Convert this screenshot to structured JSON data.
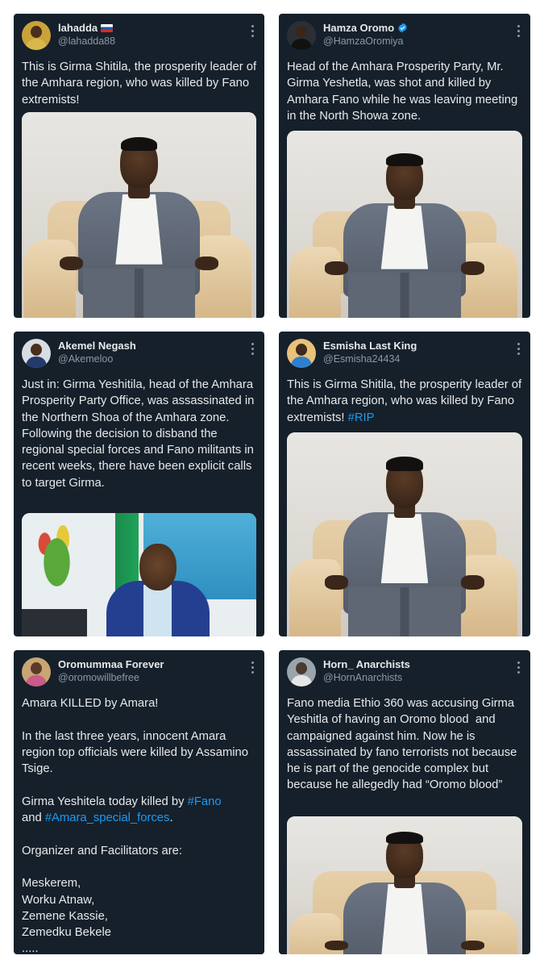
{
  "tweets": [
    {
      "name": "lahadda",
      "handle": "@lahadda88",
      "text": "This is Girma Shitila, the prosperity leader of the Amhara region, who was killed by Fano extremists!",
      "hashtag": "",
      "has_flag": true,
      "verified": false,
      "photo": "man-in-grey-suit-on-sofa"
    },
    {
      "name": "Hamza Oromo",
      "handle": "@HamzaOromiya",
      "text": "Head of the Amhara Prosperity Party, Mr. Girma Yeshetla, was shot and killed by Amhara Fano while he was leaving meeting in the North Showa zone.",
      "hashtag": "",
      "has_flag": false,
      "verified": true,
      "photo": "man-in-grey-suit-on-sofa"
    },
    {
      "name": "Akemel Negash",
      "handle": "@Akemeloo",
      "text": "Just in: Girma Yeshitila, head of the Amhara Prosperity Party Office, was assassinated in the Northern Shoa of the Amhara zone. Following the decision to disband the regional special forces and Fano militants in recent weeks, there have been explicit calls to target Girma.",
      "hashtag": "",
      "has_flag": false,
      "verified": false,
      "photo": "man-at-desk-in-office"
    },
    {
      "name": "Esmisha Last King",
      "handle": "@Esmisha24434",
      "text": "This is Girma Shitila, the prosperity leader of the Amhara region, who was killed by Fano extremists! ",
      "hashtag": "#RIP",
      "has_flag": false,
      "verified": false,
      "photo": "man-in-grey-suit-on-sofa"
    },
    {
      "name": "Oromummaa Forever",
      "handle": "@oromowillbefree",
      "text_intro": "Amara KILLED by Amara!\n\nIn the last three years, innocent Amara region top officials were killed by Assamino Tsige.\n\nGirma Yeshitela today killed by ",
      "hashtag1": "#Fano",
      "text_and": "\nand ",
      "hashtag2": "#Amara_special_forces",
      "text_outro": ".\n\nOrganizer and Facilitators are:\n\nMeskerem,\nWorku Atnaw,\nZemene Kassie,\nZemedku Bekele\n.....",
      "has_flag": false,
      "verified": false
    },
    {
      "name": "Horn_ Anarchists",
      "handle": "@HornAnarchists",
      "text": "Fano media Ethio 360 was accusing Girma Yeshitla of having an Oromo blood  and campaigned against him. Now he is assassinated by fano terrorists not because he is part of the genocide complex but because he allegedly had “Oromo blood”",
      "hashtag": "",
      "has_flag": false,
      "verified": false,
      "photo": "man-in-grey-suit-on-sofa"
    }
  ],
  "icons": {
    "more": "more-vertical-icon",
    "verified": "verified-badge-icon",
    "flag": "russia-flag-icon"
  },
  "colors": {
    "card_bg": "#15202b",
    "text": "#e7e9ea",
    "muted": "#8b98a5",
    "link": "#1d9bf0"
  }
}
